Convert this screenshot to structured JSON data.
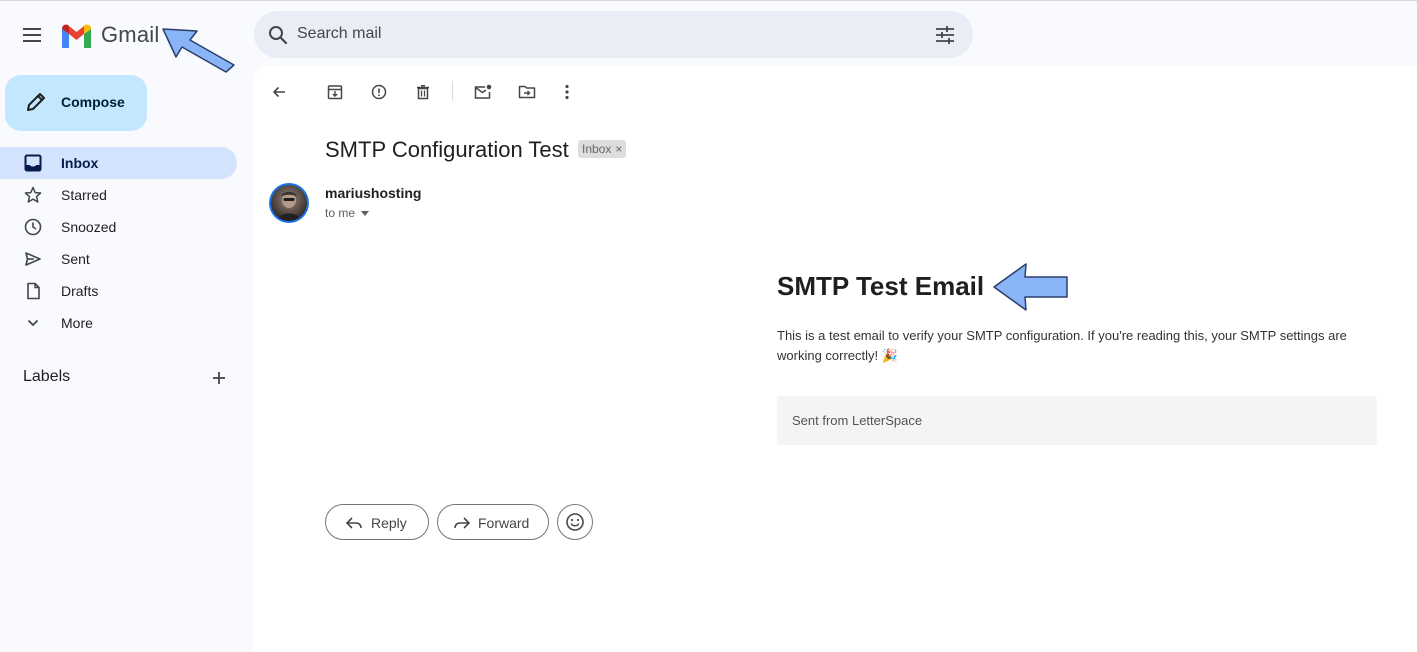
{
  "app": {
    "name": "Gmail"
  },
  "search": {
    "placeholder": "Search mail"
  },
  "sidebar": {
    "compose_label": "Compose",
    "items": [
      {
        "label": "Inbox",
        "icon": "inbox-icon",
        "active": true
      },
      {
        "label": "Starred",
        "icon": "star-icon"
      },
      {
        "label": "Snoozed",
        "icon": "clock-icon"
      },
      {
        "label": "Sent",
        "icon": "send-icon"
      },
      {
        "label": "Drafts",
        "icon": "draft-icon"
      },
      {
        "label": "More",
        "icon": "chevron-down-icon"
      }
    ],
    "labels_title": "Labels"
  },
  "message": {
    "subject": "SMTP Configuration Test",
    "chip": "Inbox",
    "chip_close": "×",
    "sender": "mariushosting",
    "recipient": "to me",
    "body_heading": "SMTP Test Email",
    "body_text": "This is a test email to verify your SMTP configuration. If you're reading this, your SMTP settings are working correctly! 🎉",
    "footer": "Sent from LetterSpace"
  },
  "actions": {
    "reply": "Reply",
    "forward": "Forward"
  },
  "colors": {
    "accent": "#0b57d0",
    "compose_bg": "#c2e7ff",
    "active_nav": "#d3e3fd",
    "search_bg": "#e9eef6",
    "callout_arrow": "#8ab4f8"
  }
}
